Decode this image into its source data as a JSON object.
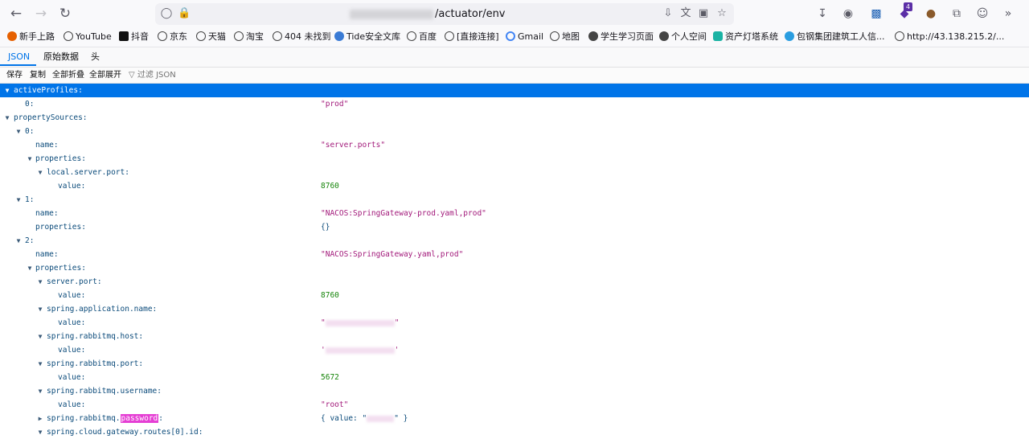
{
  "browser": {
    "url_path": "/actuator/env",
    "extensions_badge": "4"
  },
  "bookmarks": [
    {
      "label": "新手上路",
      "icon": "firefox-icon"
    },
    {
      "label": "YouTube",
      "icon": "globe-icon"
    },
    {
      "label": "抖音",
      "icon": "tiktok-icon"
    },
    {
      "label": "京东",
      "icon": "globe-icon"
    },
    {
      "label": "天猫",
      "icon": "globe-icon"
    },
    {
      "label": "淘宝",
      "icon": "globe-icon"
    },
    {
      "label": "404 未找到",
      "icon": "globe-icon"
    },
    {
      "label": "Tide安全文库",
      "icon": "tide-icon"
    },
    {
      "label": "百度",
      "icon": "globe-icon"
    },
    {
      "label": "[直接连接]",
      "icon": "globe-icon"
    },
    {
      "label": "Gmail",
      "icon": "google-icon"
    },
    {
      "label": "地图",
      "icon": "globe-icon"
    },
    {
      "label": "学生学习页面",
      "icon": "globe-dark-icon"
    },
    {
      "label": "个人空间",
      "icon": "globe-dark-icon"
    },
    {
      "label": "资产灯塔系统",
      "icon": "lighthouse-icon"
    },
    {
      "label": "包钢集团建筑工人信...",
      "icon": "eye-icon"
    },
    {
      "label": "http://43.138.215.2/...",
      "icon": "globe-icon"
    }
  ],
  "viewer": {
    "tabs": [
      "JSON",
      "原始数据",
      "头"
    ],
    "actions": [
      "保存",
      "复制",
      "全部折叠",
      "全部展开"
    ],
    "filter_placeholder": "过滤 JSON"
  },
  "json_rows": [
    {
      "key": "activeProfiles:",
      "value": "",
      "type": "none"
    },
    {
      "key": "0:",
      "value": "\"prod\"",
      "type": "str"
    },
    {
      "key": "propertySources:",
      "value": "",
      "type": "none"
    },
    {
      "key": "0:",
      "value": "",
      "type": "none"
    },
    {
      "key": "name:",
      "value": "\"server.ports\"",
      "type": "str"
    },
    {
      "key": "properties:",
      "value": "",
      "type": "none"
    },
    {
      "key": "local.server.port:",
      "value": "",
      "type": "none"
    },
    {
      "key": "value:",
      "value": "8760",
      "type": "num"
    },
    {
      "key": "1:",
      "value": "",
      "type": "none"
    },
    {
      "key": "name:",
      "value": "\"NACOS:SpringGateway-prod.yaml,prod\"",
      "type": "str"
    },
    {
      "key": "properties:",
      "value": "{}",
      "type": "obj"
    },
    {
      "key": "2:",
      "value": "",
      "type": "none"
    },
    {
      "key": "name:",
      "value": "\"NACOS:SpringGateway.yaml,prod\"",
      "type": "str"
    },
    {
      "key": "properties:",
      "value": "",
      "type": "none"
    },
    {
      "key": "server.port:",
      "value": "",
      "type": "none"
    },
    {
      "key": "value:",
      "value": "8760",
      "type": "num"
    },
    {
      "key": "spring.application.name:",
      "value": "",
      "type": "none"
    },
    {
      "key": "value:",
      "value": "\"",
      "type": "redacted"
    },
    {
      "key": "spring.rabbitmq.host:",
      "value": "",
      "type": "none"
    },
    {
      "key": "value:",
      "value": "'",
      "type": "redacted"
    },
    {
      "key": "spring.rabbitmq.port:",
      "value": "",
      "type": "none"
    },
    {
      "key": "value:",
      "value": "5672",
      "type": "num"
    },
    {
      "key": "spring.rabbitmq.username:",
      "value": "",
      "type": "none"
    },
    {
      "key": "value:",
      "value": "\"root\"",
      "type": "str"
    },
    {
      "key_prefix": "spring.rabbitmq.",
      "key_highlight": "password",
      "key_suffix": ":",
      "value": "{ value: \"",
      "value_end": "\" }",
      "type": "redacted-obj"
    },
    {
      "key": "spring.cloud.gateway.routes[0].id:",
      "value": "",
      "type": "none"
    }
  ]
}
